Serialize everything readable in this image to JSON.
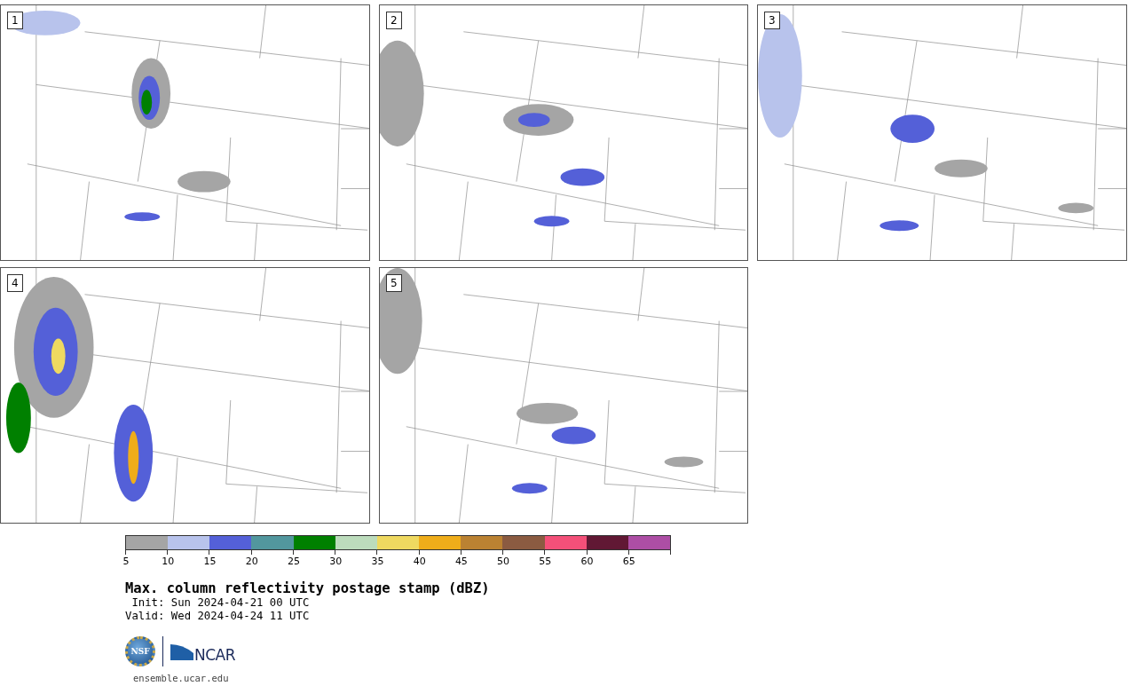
{
  "panels": [
    {
      "label": "1"
    },
    {
      "label": "2"
    },
    {
      "label": "3"
    },
    {
      "label": "4"
    },
    {
      "label": "5"
    }
  ],
  "legend": {
    "bins": [
      {
        "label": "5",
        "color": "#a5a5a5"
      },
      {
        "label": "10",
        "color": "#b8c3ec"
      },
      {
        "label": "15",
        "color": "#5460d8"
      },
      {
        "label": "20",
        "color": "#52979e"
      },
      {
        "label": "25",
        "color": "#008000"
      },
      {
        "label": "30",
        "color": "#bcdcbc"
      },
      {
        "label": "35",
        "color": "#efd960"
      },
      {
        "label": "40",
        "color": "#efad1a"
      },
      {
        "label": "45",
        "color": "#bb8232"
      },
      {
        "label": "50",
        "color": "#8b5b41"
      },
      {
        "label": "55",
        "color": "#f45079"
      },
      {
        "label": "60",
        "color": "#611834"
      },
      {
        "label": "65",
        "color": "#ad4ea5"
      }
    ]
  },
  "title": "Max. column reflectivity postage stamp (dBZ)",
  "init": "Init: Sun 2024-04-21 00 UTC",
  "valid": "Valid: Wed 2024-04-24 11 UTC",
  "logo": {
    "nsf": "NSF",
    "ncar": "NCAR"
  },
  "site": "ensemble.ucar.edu"
}
